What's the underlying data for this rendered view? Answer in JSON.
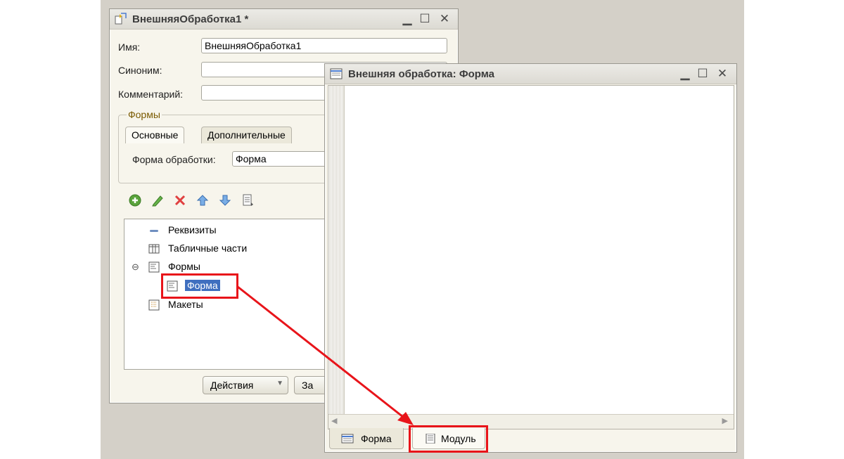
{
  "colors": {
    "highlight": "#e8141a",
    "selection": "#3f6fbf",
    "desktop": "#d4d0c8"
  },
  "processing_window": {
    "title": "ВнешняяОбработка1 *",
    "name_label": "Имя:",
    "name_value": "ВнешняяОбработка1",
    "synonym_label": "Синоним:",
    "synonym_value": "",
    "comment_label": "Комментарий:",
    "comment_value": "",
    "forms_group_title": "Формы",
    "tabs": [
      {
        "label": "Основные",
        "active": true
      },
      {
        "label": "Дополнительные",
        "active": false
      }
    ],
    "processing_form_label": "Форма обработки:",
    "processing_form_value": "Форма",
    "toolbar_icons": [
      "add-icon",
      "edit-icon",
      "delete-icon",
      "move-up-icon",
      "move-down-icon",
      "list-icon"
    ],
    "tree": [
      {
        "label": "Реквизиты",
        "icon": "attribute-icon"
      },
      {
        "label": "Табличные части",
        "icon": "table-icon"
      },
      {
        "label": "Формы",
        "icon": "forms-icon",
        "expanded": true
      },
      {
        "label": "Форма",
        "icon": "form-icon",
        "selected": true
      },
      {
        "label": "Макеты",
        "icon": "template-icon"
      }
    ],
    "actions_button": "Действия",
    "close_button_partial": "За"
  },
  "form_window": {
    "title": "Внешняя обработка: Форма",
    "bottom_tabs": [
      {
        "label": "Форма",
        "active": false
      },
      {
        "label": "Модуль",
        "active": true
      }
    ]
  }
}
